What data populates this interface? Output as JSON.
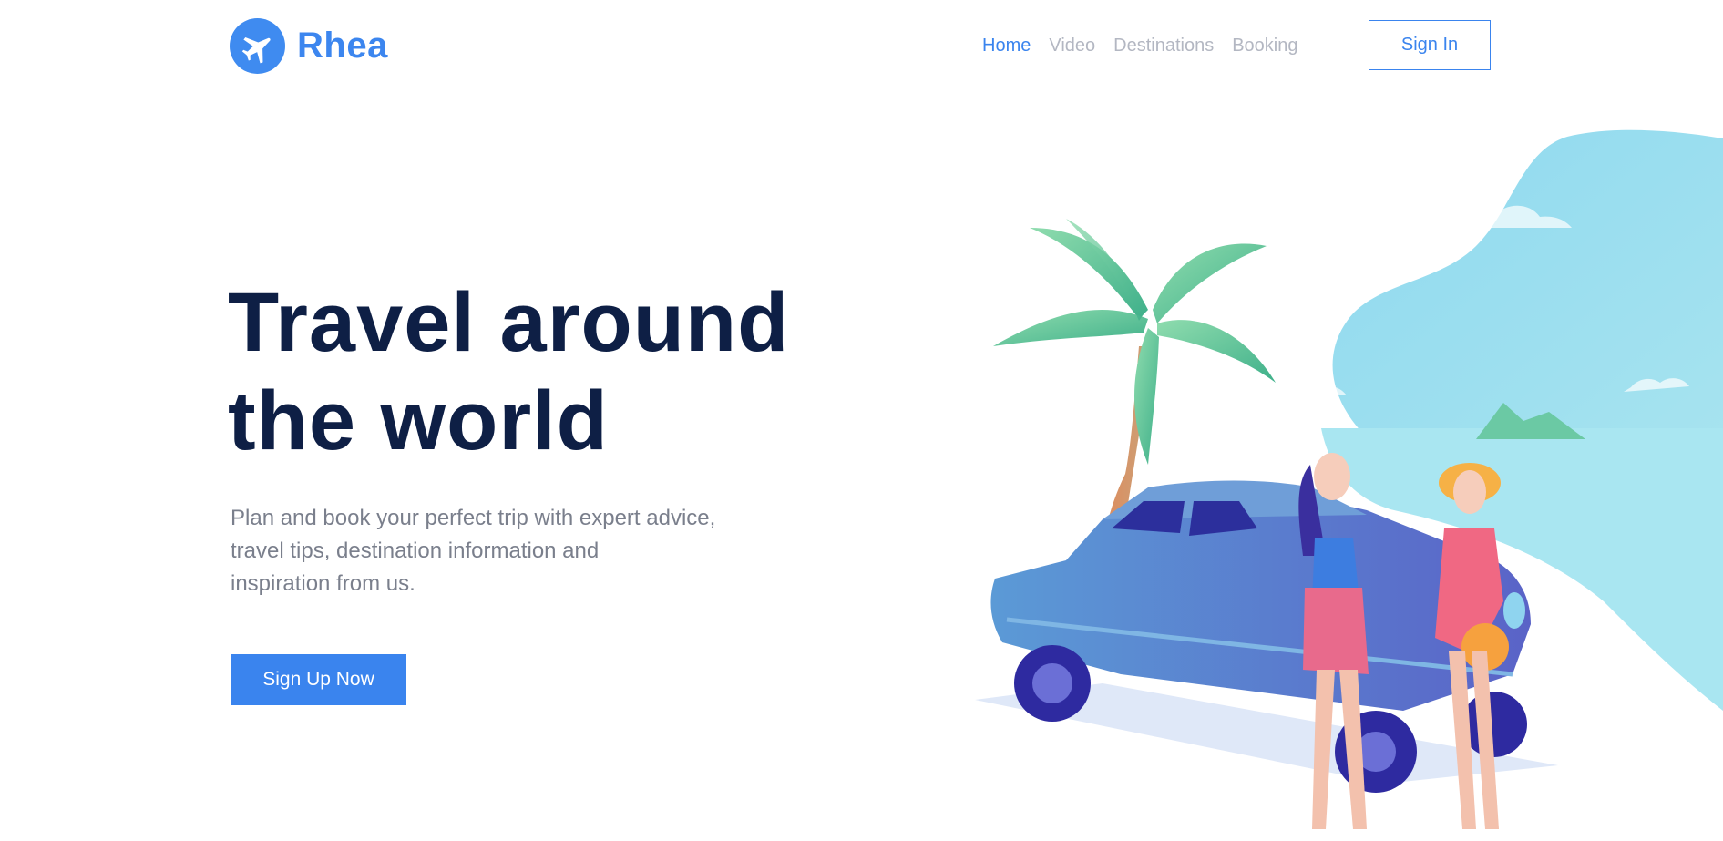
{
  "brand": {
    "name": "Rhea",
    "logo_icon": "airplane-icon",
    "color": "#3c86ef"
  },
  "nav": {
    "items": [
      {
        "label": "Home",
        "active": true
      },
      {
        "label": "Video",
        "active": false
      },
      {
        "label": "Destinations",
        "active": false
      },
      {
        "label": "Booking",
        "active": false
      }
    ],
    "signin_label": "Sign In"
  },
  "hero": {
    "title_lines": [
      "Travel around",
      "the world"
    ],
    "subtitle_lines": [
      "Plan and book your perfect trip with expert advice,",
      "travel tips, destination information and",
      "inspiration from us."
    ],
    "cta_label": "Sign Up Now"
  },
  "colors": {
    "accent": "#3a84ee",
    "heading": "#0e1f45",
    "muted": "#7a7f8c",
    "nav_inactive": "#b3b7c2"
  }
}
